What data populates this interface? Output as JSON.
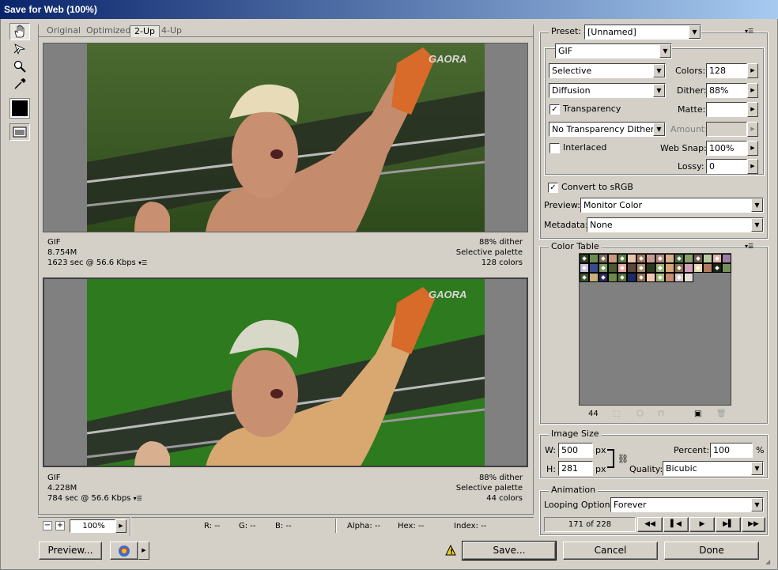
{
  "window": {
    "title": "Save for Web (100%)"
  },
  "tabs": [
    {
      "label": "Original"
    },
    {
      "label": "Optimized"
    },
    {
      "label": "2-Up"
    },
    {
      "label": "4-Up"
    }
  ],
  "panes": [
    {
      "format": "GIF",
      "size": "8.754M",
      "time": "1623 sec @ 56.6 Kbps",
      "dither": "88% dither",
      "palette": "Selective palette",
      "colors": "128 colors",
      "watermark": "GAORA"
    },
    {
      "format": "GIF",
      "size": "4.228M",
      "time": "784 sec @ 56.6 Kbps",
      "dither": "88% dither",
      "palette": "Selective palette",
      "colors": "44 colors",
      "watermark": "GAORA"
    }
  ],
  "preset": {
    "label": "Preset:",
    "value": "[Unnamed]"
  },
  "format": {
    "value": "GIF"
  },
  "reduction": {
    "value": "Selective"
  },
  "colors": {
    "label": "Colors:",
    "value": "128"
  },
  "dither_algo": {
    "value": "Diffusion"
  },
  "dither": {
    "label": "Dither:",
    "value": "88%"
  },
  "transparency": {
    "label": "Transparency",
    "checked": true
  },
  "matte": {
    "label": "Matte:",
    "value": ""
  },
  "trans_dither": {
    "value": "No Transparency Dither"
  },
  "amount": {
    "label": "Amount:",
    "value": ""
  },
  "interlaced": {
    "label": "Interlaced",
    "checked": false
  },
  "web_snap": {
    "label": "Web Snap:",
    "value": "100%"
  },
  "lossy": {
    "label": "Lossy:",
    "value": "0"
  },
  "srgb": {
    "label": "Convert to sRGB",
    "checked": true
  },
  "preview_sel": {
    "label": "Preview:",
    "value": "Monitor Color"
  },
  "metadata": {
    "label": "Metadata:",
    "value": "None"
  },
  "color_table": {
    "title": "Color Table",
    "count": "44",
    "colors": [
      "#2f3f24",
      "#6b8b4e",
      "#7d6a52",
      "#c89b7d",
      "#5a7a3c",
      "#e7c3b0",
      "#a0725a",
      "#c69a94",
      "#b3867a",
      "#d7b08f",
      "#4d6e3a",
      "#8aa06a",
      "#6f5d4f",
      "#b7c9a0",
      "#e0b2a7",
      "#9b7fa0",
      "#c4c0d6",
      "#3b4a8c",
      "#7a9a5c",
      "#4a5a2e",
      "#e6a4a0",
      "#5c4838",
      "#a78c6a",
      "#2e3a1e",
      "#9cb07a",
      "#d4a67a",
      "#8c7050",
      "#cfa0b8",
      "#e8d8b0",
      "#b27a5e",
      "#1a2410",
      "#74905a",
      "#3e5230",
      "#c8b078",
      "#2c2860",
      "#6e8a48",
      "#5a6e3a",
      "#1e2a64",
      "#8e6e4e",
      "#f0c8b0",
      "#a4b878",
      "#c48c70",
      "#d8c8c8",
      "#e8e0d8"
    ]
  },
  "image_size": {
    "title": "Image Size",
    "w_label": "W:",
    "w": "500",
    "h_label": "H:",
    "h": "281",
    "unit": "px",
    "percent_label": "Percent:",
    "percent": "100",
    "pct": "%",
    "quality_label": "Quality:",
    "quality": "Bicubic"
  },
  "animation": {
    "title": "Animation",
    "looping_label": "Looping Options:",
    "looping": "Forever",
    "frame": "171 of 228"
  },
  "status": {
    "zoom": "100%",
    "r": "R: --",
    "g": "G: --",
    "b": "B: --",
    "alpha": "Alpha: --",
    "hex": "Hex: --",
    "index": "Index: --"
  },
  "buttons": {
    "preview": "Preview...",
    "save": "Save...",
    "cancel": "Cancel",
    "done": "Done"
  }
}
